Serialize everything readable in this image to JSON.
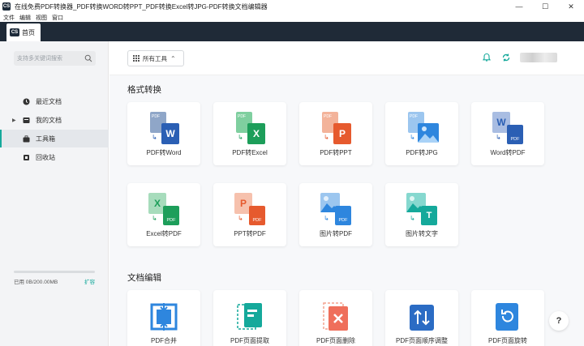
{
  "window": {
    "app_logo": "CS",
    "title": "在线免费PDF转换器_PDF转换WORD转PPT_PDF转换Excel转JPG-PDF转换文档编辑器",
    "min_icon": "—",
    "max_icon": "☐",
    "close_icon": "✕"
  },
  "menu": [
    "文件",
    "编辑",
    "视图",
    "窗口"
  ],
  "tab": {
    "logo": "CS",
    "label": "首页"
  },
  "sidebar": {
    "search_placeholder": "支持多关键词搜索",
    "items": [
      {
        "label": "最近文档",
        "icon": "clock-icon"
      },
      {
        "label": "我的文档",
        "icon": "folder-icon"
      },
      {
        "label": "工具箱",
        "icon": "toolbox-icon",
        "active": true
      },
      {
        "label": "回收站",
        "icon": "trash-icon"
      }
    ],
    "storage_text": "已用 0B/200.00MB",
    "storage_used_fraction": 0,
    "expand_label": "扩容"
  },
  "header": {
    "all_tools_label": "所有工具",
    "chevron": "⌃"
  },
  "sections": {
    "format": {
      "title": "格式转换",
      "tools": [
        {
          "label": "PDF转Word",
          "icon": "pdf-to-word-icon"
        },
        {
          "label": "PDF转Excel",
          "icon": "pdf-to-excel-icon"
        },
        {
          "label": "PDF转PPT",
          "icon": "pdf-to-ppt-icon"
        },
        {
          "label": "PDF转JPG",
          "icon": "pdf-to-jpg-icon"
        },
        {
          "label": "Word转PDF",
          "icon": "word-to-pdf-icon"
        },
        {
          "label": "Excel转PDF",
          "icon": "excel-to-pdf-icon"
        },
        {
          "label": "PPT转PDF",
          "icon": "ppt-to-pdf-icon"
        },
        {
          "label": "图片转PDF",
          "icon": "image-to-pdf-icon"
        },
        {
          "label": "图片转文字",
          "icon": "image-to-text-icon"
        }
      ]
    },
    "edit": {
      "title": "文档编辑",
      "tools": [
        {
          "label": "PDF合并",
          "icon": "pdf-merge-icon"
        },
        {
          "label": "PDF页面提取",
          "icon": "pdf-extract-icon"
        },
        {
          "label": "PDF页面删除",
          "icon": "pdf-delete-icon"
        },
        {
          "label": "PDF页面顺序调整",
          "icon": "pdf-reorder-icon"
        },
        {
          "label": "PDF页面旋转",
          "icon": "pdf-rotate-icon"
        }
      ]
    }
  },
  "help_label": "?",
  "badges": {
    "pdf": "PDF",
    "word": "W",
    "excel": "X",
    "ppt": "P",
    "text": "T"
  },
  "colors": {
    "accent": "#15a99b",
    "word": "#2b5fb4",
    "excel": "#1d9e5a",
    "ppt": "#e65a2e",
    "image": "#2e86de",
    "pdf_tag": "#8fa6c8"
  }
}
